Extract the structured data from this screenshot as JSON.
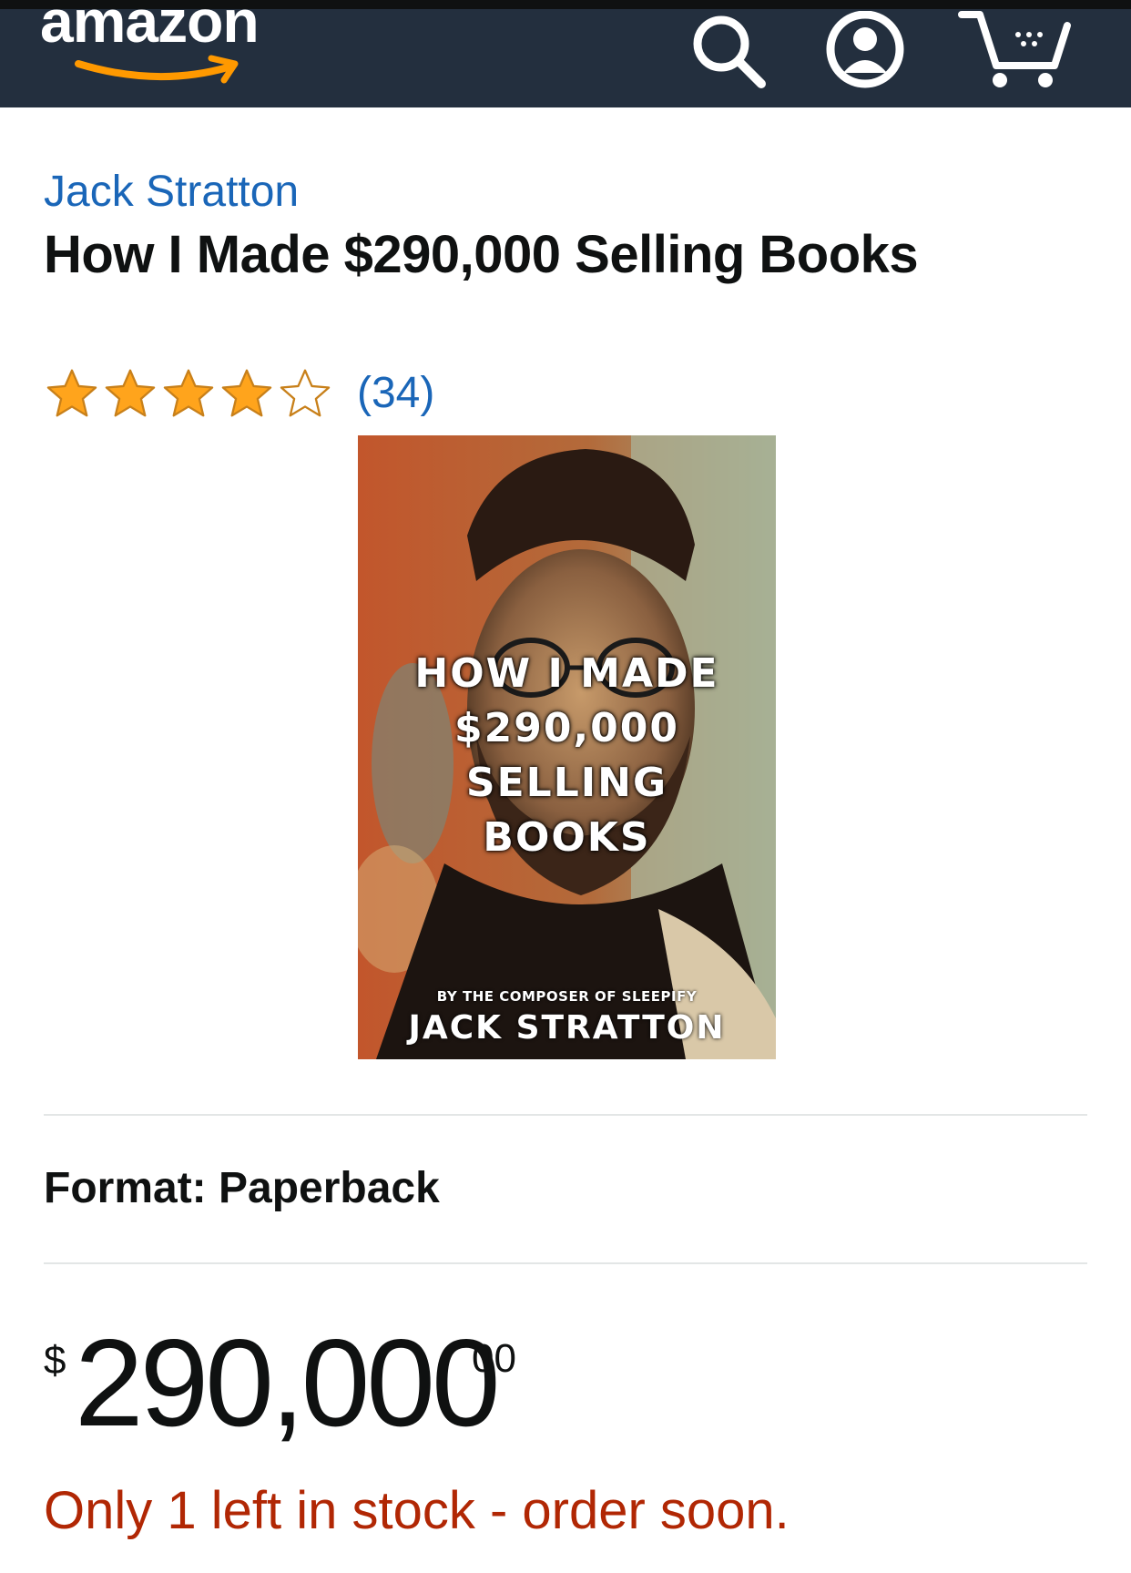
{
  "header": {
    "logo_text": "amazon",
    "icons": [
      "search-icon",
      "account-icon",
      "cart-icon"
    ],
    "background_color": "#232f3e",
    "logo_smile_color": "#f90"
  },
  "product": {
    "author": "Jack Stratton",
    "title": "How I Made $290,000 Selling Books",
    "rating": {
      "stars": 4,
      "max_stars": 5,
      "count_label": "(34)"
    },
    "cover": {
      "title_lines": [
        "HOW I MADE",
        "$290,000",
        "SELLING",
        "BOOKS"
      ],
      "byline": "BY THE COMPOSER OF SLEEPIFY",
      "author": "JACK STRATTON"
    },
    "format_label": "Format: Paperback",
    "price": {
      "symbol": "$",
      "whole": "290,000",
      "fraction": "00"
    },
    "stock_message": "Only 1 left in stock - order soon."
  },
  "colors": {
    "link": "#1a66b8",
    "star_fill": "#ffa41c",
    "stock_warning": "#b12704"
  }
}
